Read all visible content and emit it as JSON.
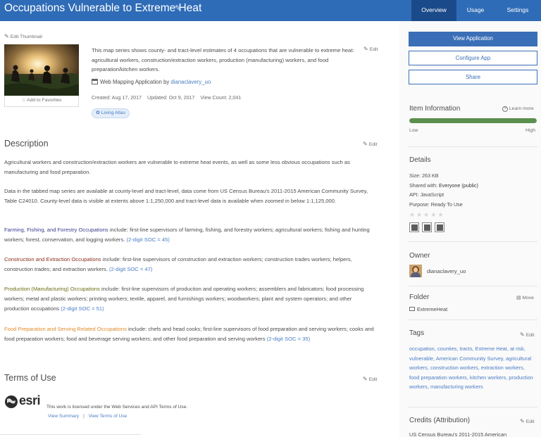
{
  "header": {
    "title": "Occupations Vulnerable to Extreme Heat",
    "tabs": [
      "Overview",
      "Usage",
      "Settings"
    ]
  },
  "thumbnail": {
    "edit_label": "Edit Thumbnail",
    "favorite_label": "Add to Favorites"
  },
  "summary": {
    "text": "This map series shows county- and tract-level estimates of 4 occupations that are vulnerable to extreme heat: agricultural workers, construction/extraction workers, production (manufacturing) workers, and food preparation/kitchen workers.",
    "edit_label": "Edit",
    "type_label": "Web Mapping Application by ",
    "owner_link": "dianaclavery_uo",
    "created": "Created: Aug 17, 2017",
    "updated": "Updated: Oct 9, 2017",
    "views": "View Count: 2,041",
    "badge": "Living Atlas"
  },
  "description": {
    "heading": "Description",
    "edit_label": "Edit",
    "p1": "Agricultural workers and construction/extraction workers are vulnerable to extreme heat events, as well as some less obvious occupations such as manufacturing and food preparation.",
    "p2": "Data in the tabbed map series are available at county-level and tract-level, data come from US Census Bureau's 2011-2015 American Community Survey, Table C24010.  County-level data is visible at extents above 1:1,250,000 and tract-level data is available when zoomed in below 1:1,125,000.",
    "occupations": [
      {
        "title": "Farming, Fishing, and Forestry Occupations",
        "text": " include: first-line supervisors of farming, fishing, and forestry workers; agricultural workers; fishing and hunting workers; forest, conservation, and logging workers. ",
        "soc": "(2-digit SOC = 45)"
      },
      {
        "title": "Construction and Extraction Occupations",
        "text": " include: first-line supervisors of construction and extraction workers; construction trades workers; helpers, construction trades; and extraction workers. ",
        "soc": "(2-digit SOC = 47)"
      },
      {
        "title": "Production (Manufacturing) Occupations",
        "text": " include: first-line supervisors of production and operating workers; assemblers and fabricators; food processing workers; metal and plastic workers; printing workers; textile, apparel, and furnishings workers; woodworkers; plant and system operators; and other production occupations ",
        "soc": "(2-digit SOC = 51)"
      },
      {
        "title": "Food Preparation and Serving Related Occupations",
        "text": " include: chefs and head cooks; first-line supervisors of food preparation and serving workers; cooks and food preparation workers; food and beverage serving workers; and other food preparation and serving workers ",
        "soc": "(2-digit SOC = 35)"
      }
    ]
  },
  "terms": {
    "heading": "Terms of Use",
    "edit_label": "Edit",
    "logo_text": "esri",
    "license": "This work is licensed under the Web Services and API Terms of Use.",
    "view_summary": "View Summary",
    "separator": "|",
    "view_terms": "View Terms of Use"
  },
  "sidebar": {
    "view_app": "View Application",
    "configure_app": "Configure App",
    "share": "Share",
    "item_info": {
      "heading": "Item Information",
      "learn_more": "Learn more",
      "low": "Low",
      "high": "High",
      "level": 1.0
    },
    "details": {
      "heading": "Details",
      "size": "Size: 263 KB",
      "shared_label": "Shared with: ",
      "shared_value": "Everyone (public)",
      "api": "API: JavaScript",
      "purpose": "Purpose: Ready To Use",
      "rating_stars": 0
    },
    "owner": {
      "heading": "Owner",
      "name": "dianaclavery_uo"
    },
    "folder": {
      "heading": "Folder",
      "move_label": "Move",
      "name": "ExtremeHeat"
    },
    "tags": {
      "heading": "Tags",
      "edit_label": "Edit",
      "text": "occupation, counties, tracts, Extreme Heat, at risk, vulnerable, American Community Survey, agricultural workers, construction workers, extraction workers, food preparation workers, kitchen workers, production workers, manufacturing workers"
    },
    "credits": {
      "heading": "Credits (Attribution)",
      "edit_label": "Edit",
      "text": "US Census Bureau's 2011-2015 American"
    }
  },
  "colors": {
    "header_bg": "#2f6cb7",
    "active_tab": "#1b4a8a",
    "primary_button": "#3a6fb7",
    "progress_fill": "#5a8f4d",
    "link": "#4a7cc4"
  }
}
